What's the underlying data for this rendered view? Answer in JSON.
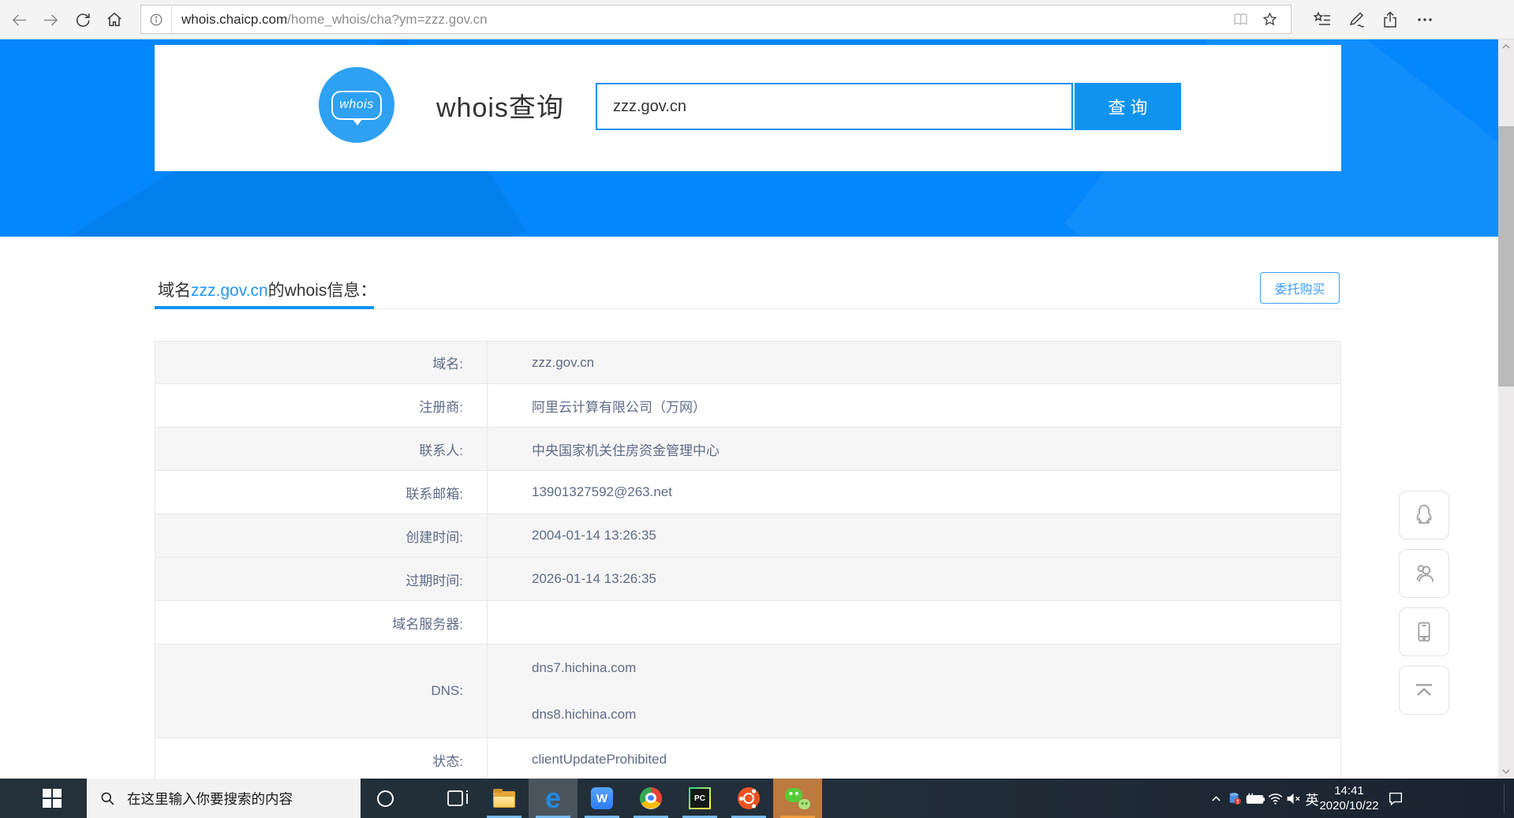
{
  "browser": {
    "url_host": "whois.chaicp.com",
    "url_path": "/home_whois/cha?ym=zzz.gov.cn",
    "toolbar_icons": [
      "back",
      "forward",
      "refresh",
      "home",
      "page-info",
      "reading-view",
      "favorite-star",
      "hub",
      "ink-notes",
      "share",
      "settings-more"
    ]
  },
  "header": {
    "logo_text": "whois",
    "title": "whois查询",
    "search_value": "zzz.gov.cn",
    "search_button_label": "查 询"
  },
  "result": {
    "heading_prefix": "域名",
    "heading_domain": "zzz.gov.cn",
    "heading_suffix": "的whois信息：",
    "buy_button_label": "委托购买"
  },
  "whois_table": {
    "rows": [
      {
        "label": "域名:",
        "values": [
          "zzz.gov.cn"
        ],
        "shaded": true
      },
      {
        "label": "注册商:",
        "values": [
          "阿里云计算有限公司（万网）"
        ],
        "shaded": false
      },
      {
        "label": "联系人:",
        "values": [
          "中央国家机关住房资金管理中心"
        ],
        "shaded": true
      },
      {
        "label": "联系邮箱:",
        "values": [
          "13901327592@263.net"
        ],
        "shaded": false
      },
      {
        "label": "创建时间:",
        "values": [
          "2004-01-14 13:26:35"
        ],
        "shaded": true
      },
      {
        "label": "过期时间:",
        "values": [
          "2026-01-14 13:26:35"
        ],
        "shaded": true
      },
      {
        "label": "域名服务器:",
        "values": [
          ""
        ],
        "shaded": false
      },
      {
        "label": "DNS:",
        "values": [
          "dns7.hichina.com",
          "dns8.hichina.com"
        ],
        "shaded": true
      },
      {
        "label": "状态:",
        "values": [
          "clientUpdateProhibited"
        ],
        "shaded": false
      }
    ]
  },
  "float_buttons": [
    "qq",
    "group",
    "mobile",
    "back-to-top"
  ],
  "taskbar": {
    "search_placeholder": "在这里输入你要搜索的内容",
    "apps": [
      {
        "name": "task-view",
        "running": false
      },
      {
        "name": "file-explorer",
        "running": true
      },
      {
        "name": "edge",
        "running": true,
        "active": true
      },
      {
        "name": "wps",
        "running": true
      },
      {
        "name": "chrome",
        "running": true
      },
      {
        "name": "pycharm",
        "running": true
      },
      {
        "name": "ubuntu",
        "running": true
      },
      {
        "name": "wechat",
        "running": true,
        "attention": true
      }
    ],
    "tray_icons": [
      "hidden-icons-chevron",
      "cloud-sync",
      "battery",
      "wifi",
      "volume-muted"
    ],
    "language_indicator": "英",
    "time": "14:41",
    "date": "2020/10/22"
  },
  "colors": {
    "band_blue": "#0487fa",
    "accent_blue": "#0e93f0",
    "logo_blue": "#2ea1f2",
    "link_blue": "#2196f3",
    "buy_blue": "#3d9ef8",
    "table_text": "#5d6c87",
    "row_shade": "#f5f5f5",
    "running_indicator": "#76b9ed",
    "wechat_highlight": "#bc7940",
    "wechat_indicator": "#f09b3c"
  }
}
